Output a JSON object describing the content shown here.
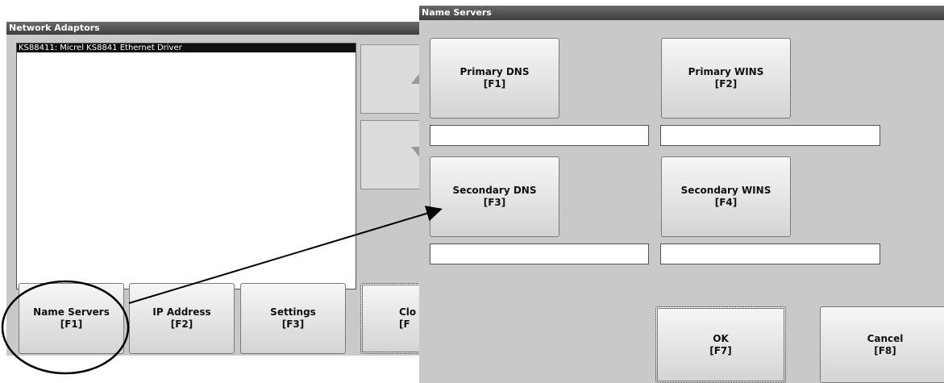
{
  "network_adaptors": {
    "title": "Network Adaptors",
    "adaptor_list": [
      "KS88411: Micrel KS8841 Ethernet Driver"
    ],
    "buttons": [
      {
        "label": "Name Servers",
        "key": "[F1]"
      },
      {
        "label": "IP Address",
        "key": "[F2]"
      },
      {
        "label": "Settings",
        "key": "[F3]"
      },
      {
        "label": "Clo",
        "key": "[F"
      }
    ]
  },
  "name_servers": {
    "title": "Name Servers",
    "primary_dns": {
      "label": "Primary DNS",
      "key": "[F1]",
      "value": ""
    },
    "primary_wins": {
      "label": "Primary WINS",
      "key": "[F2]",
      "value": ""
    },
    "secondary_dns": {
      "label": "Secondary DNS",
      "key": "[F3]",
      "value": ""
    },
    "secondary_wins": {
      "label": "Secondary WINS",
      "key": "[F4]",
      "value": ""
    },
    "ok": {
      "label": "OK",
      "key": "[F7]"
    },
    "cancel": {
      "label": "Cancel",
      "key": "[F8]"
    }
  },
  "icons": [
    "scroll-up-icon",
    "scroll-down-icon",
    "callout-arrow-icon",
    "highlight-ellipse-icon"
  ],
  "colors": {
    "titlebar": "#4a4a4a",
    "window": "#c9c9c9",
    "selection": "#0f0f0f"
  }
}
